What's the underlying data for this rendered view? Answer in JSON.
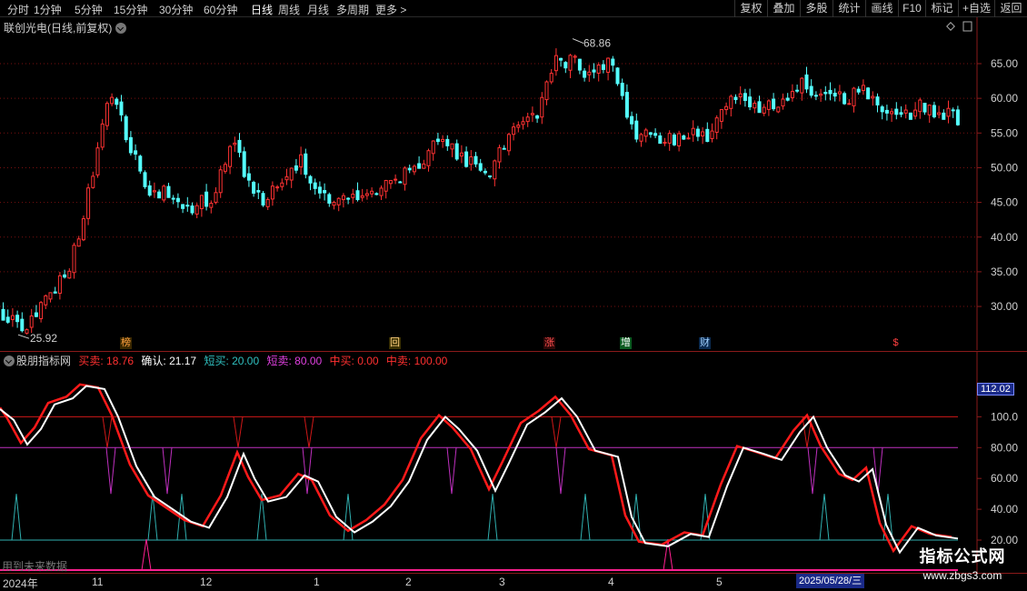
{
  "toolbar": {
    "periods": [
      "分时",
      "1分钟",
      "5分钟",
      "15分钟",
      "30分钟",
      "60分钟",
      "日线",
      "周线",
      "月线",
      "多周期",
      "更多 >"
    ],
    "active_period": "日线",
    "tools": [
      "复权",
      "叠加",
      "多股",
      "统计",
      "画线",
      "F10",
      "标记",
      "+自选",
      "返回"
    ]
  },
  "main": {
    "title": "联创光电(日线,前复权)",
    "price_axis": [
      "65.00",
      "60.00",
      "55.00",
      "50.00",
      "45.00",
      "40.00",
      "35.00",
      "30.00"
    ],
    "high_label": "68.86",
    "low_label": "25.92",
    "events": [
      {
        "label": "榜",
        "color": "#ffa040",
        "bg": "#3a2800"
      },
      {
        "label": "回",
        "color": "#ffd080",
        "bg": "#3a3000"
      },
      {
        "label": "涨",
        "color": "#ff5050",
        "bg": "#300808"
      },
      {
        "label": "增",
        "color": "#ffffff",
        "bg": "#0a5a20"
      },
      {
        "label": "财",
        "color": "#a0d0ff",
        "bg": "#0a2a50"
      },
      {
        "label": "$",
        "color": "#ff4040",
        "bg": "#000000"
      }
    ]
  },
  "indicator": {
    "name": "股朋指标网",
    "values": [
      {
        "label": "买卖: 18.76",
        "color": "#ff3030"
      },
      {
        "label": "确认: 21.17",
        "color": "#ffffff"
      },
      {
        "label": "短买: 20.00",
        "color": "#30c0c0"
      },
      {
        "label": "短卖: 80.00",
        "color": "#e040e0"
      },
      {
        "label": "中买: 0.00",
        "color": "#ff3030"
      },
      {
        "label": "中卖: 100.00",
        "color": "#ff3030"
      }
    ],
    "axis": [
      "100.0",
      "80.00",
      "60.00",
      "40.00",
      "20.00"
    ],
    "current_value": "112.02",
    "future_note": "用到未来数据"
  },
  "date_axis": {
    "labels": [
      "2024年",
      "11",
      "12",
      "1",
      "2",
      "3",
      "4",
      "5"
    ],
    "current_date": "2025/05/28/三"
  },
  "watermark": {
    "title": "指标公式网",
    "url": "www.zbgs3.com"
  },
  "colors": {
    "up": "#ff3232",
    "down": "#54ffff",
    "grid": "#7a1010"
  },
  "chart_data": {
    "type": "candlestick",
    "price_range": [
      25.92,
      68.86
    ],
    "indicator_range": [
      0,
      112.02
    ],
    "series": [
      {
        "name": "买卖",
        "last": 18.76
      },
      {
        "name": "确认",
        "last": 21.17
      },
      {
        "name": "短买",
        "last": 20.0
      },
      {
        "name": "短卖",
        "last": 80.0
      },
      {
        "name": "中买",
        "last": 0.0
      },
      {
        "name": "中卖",
        "last": 100.0
      }
    ]
  }
}
